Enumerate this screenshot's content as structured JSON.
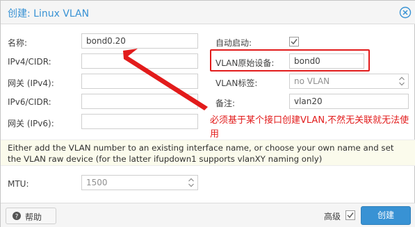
{
  "dialog": {
    "title": "创建: Linux VLAN"
  },
  "form": {
    "name_label": "名称:",
    "name_value": "bond0.20",
    "ipv4_label": "IPv4/CIDR:",
    "ipv4_value": "",
    "gw4_label": "网关 (IPv4):",
    "gw4_value": "",
    "ipv6_label": "IPv6/CIDR:",
    "ipv6_value": "",
    "gw6_label": "网关 (IPv6):",
    "gw6_value": "",
    "autostart_label": "自动启动:",
    "autostart_checked": true,
    "raw_device_label": "VLAN原始设备:",
    "raw_device_value": "bond0",
    "vlan_tag_label": "VLAN标签:",
    "vlan_tag_value": "no VLAN",
    "comment_label": "备注:",
    "comment_value": "vlan20",
    "mtu_label": "MTU:",
    "mtu_value": "1500"
  },
  "annotation": {
    "text": "必须基于某个接口创建VLAN,不然无关联就无法使用",
    "color": "#e21b1b"
  },
  "hint": {
    "text": "Either add the VLAN number to an existing interface name, or choose your own name and set the VLAN raw device (for the latter ifupdown1 supports vlanXY naming only)"
  },
  "footer": {
    "help_label": "帮助",
    "advanced_label": "高级",
    "advanced_checked": true,
    "create_label": "创建"
  },
  "colors": {
    "accent": "#3892d4",
    "annotation_red": "#e21b1b",
    "hint_bg": "#fbfbec"
  },
  "icons": {
    "close": "close-circle-icon",
    "help": "question-circle-icon",
    "checkbox": "checkmark-icon",
    "stepper": "spinner-arrows-icon"
  }
}
